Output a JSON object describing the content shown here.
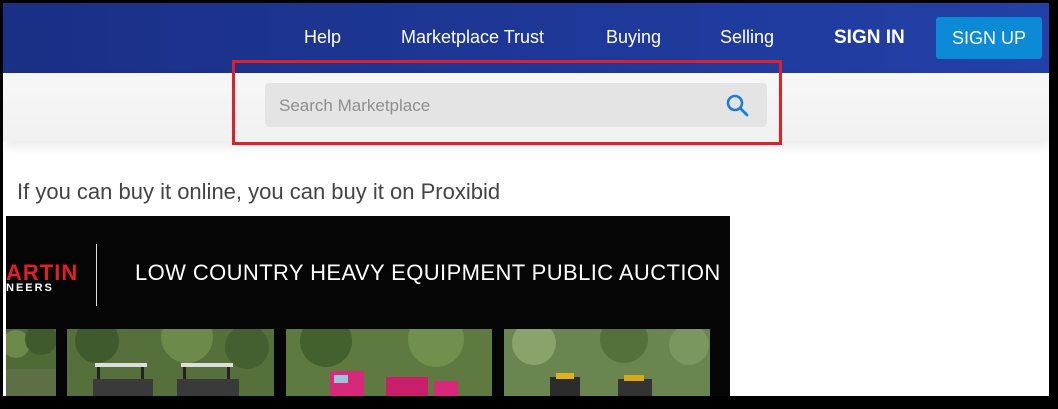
{
  "nav": {
    "links": [
      "Help",
      "Marketplace Trust",
      "Buying",
      "Selling"
    ],
    "sign_in": "SIGN IN",
    "sign_up": "SIGN UP"
  },
  "search": {
    "placeholder": "Search Marketplace",
    "icon": "search-icon"
  },
  "tagline": "If you can buy it online, you can buy it on Proxibid",
  "banner": {
    "logo_text_top": "ARTIN",
    "logo_text_bottom": "NEERS",
    "title": "LOW COUNTRY HEAVY EQUIPMENT PUBLIC AUCTION"
  },
  "colors": {
    "nav_background": "#1f3a9e",
    "sign_up_button": "#0b8ad6",
    "search_icon": "#1a7fd4",
    "highlight_box": "#e01f26",
    "banner_background": "#050505"
  }
}
